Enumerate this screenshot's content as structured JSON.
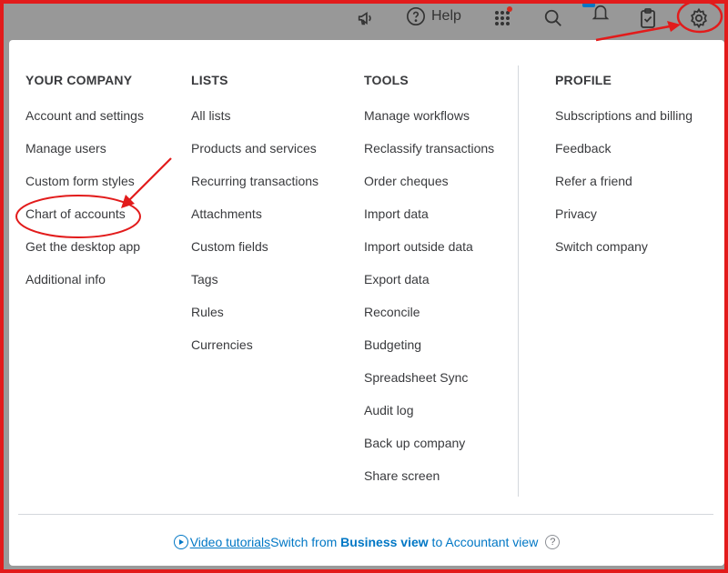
{
  "topbar": {
    "left_fragment": ".",
    "help_label": "Help",
    "icons": [
      "megaphone-icon",
      "help-icon",
      "apps-grid-icon",
      "search-icon",
      "bell-icon",
      "clipboard-icon",
      "gear-icon"
    ]
  },
  "columns": [
    {
      "heading": "YOUR COMPANY",
      "items": [
        "Account and settings",
        "Manage users",
        "Custom form styles",
        "Chart of accounts",
        "Get the desktop app",
        "Additional info"
      ]
    },
    {
      "heading": "LISTS",
      "items": [
        "All lists",
        "Products and services",
        "Recurring transactions",
        "Attachments",
        "Custom fields",
        "Tags",
        "Rules",
        "Currencies"
      ]
    },
    {
      "heading": "TOOLS",
      "items": [
        "Manage workflows",
        "Reclassify transactions",
        "Order cheques",
        "Import data",
        "Import outside data",
        "Export data",
        "Reconcile",
        "Budgeting",
        "Spreadsheet Sync",
        "Audit log",
        "Back up company",
        "Share screen"
      ]
    },
    {
      "heading": "PROFILE",
      "items": [
        "Subscriptions and billing",
        "Feedback",
        "Refer a friend",
        "Privacy",
        "Switch company"
      ]
    }
  ],
  "footer": {
    "video_tutorials": "Video tutorials",
    "switch_prefix": "Switch from ",
    "switch_bold": "Business view",
    "switch_suffix": " to Accountant view"
  },
  "colors": {
    "annotation_red": "#e21b1b",
    "link_blue": "#0077c5",
    "text": "#393a3d"
  }
}
